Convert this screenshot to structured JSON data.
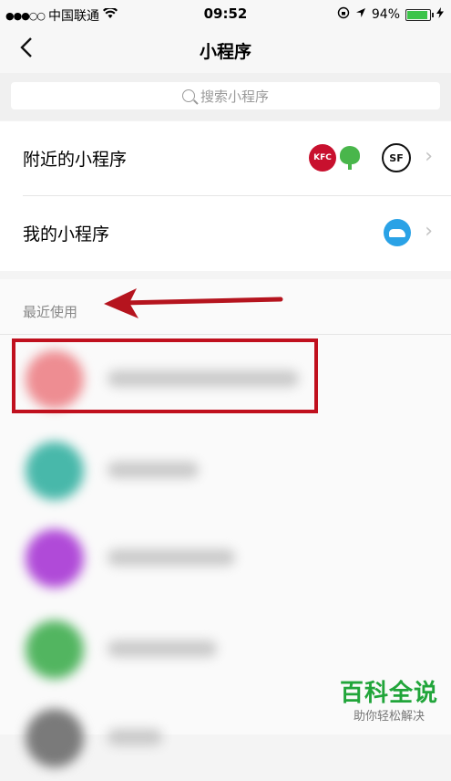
{
  "status": {
    "carrier": "中国联通",
    "time": "09:52",
    "battery": "94%"
  },
  "nav": {
    "back": "‹",
    "title": "小程序"
  },
  "search": {
    "placeholder": "搜索小程序"
  },
  "rows": [
    {
      "label": "附近的小程序",
      "logos": [
        "kfc-logo",
        "tree-logo",
        "sf-express-logo"
      ]
    },
    {
      "label": "我的小程序",
      "logos": [
        "train-logo"
      ]
    }
  ],
  "recent": {
    "label": "最近使用",
    "items": [
      {
        "color": "#ee8d92"
      },
      {
        "color": "#48b8aa"
      },
      {
        "color": "#b04ad8"
      },
      {
        "color": "#52b560"
      },
      {
        "color": "#7a7a7a"
      }
    ]
  },
  "watermark": {
    "main": "百科全说",
    "sub": "助你轻松解决"
  }
}
